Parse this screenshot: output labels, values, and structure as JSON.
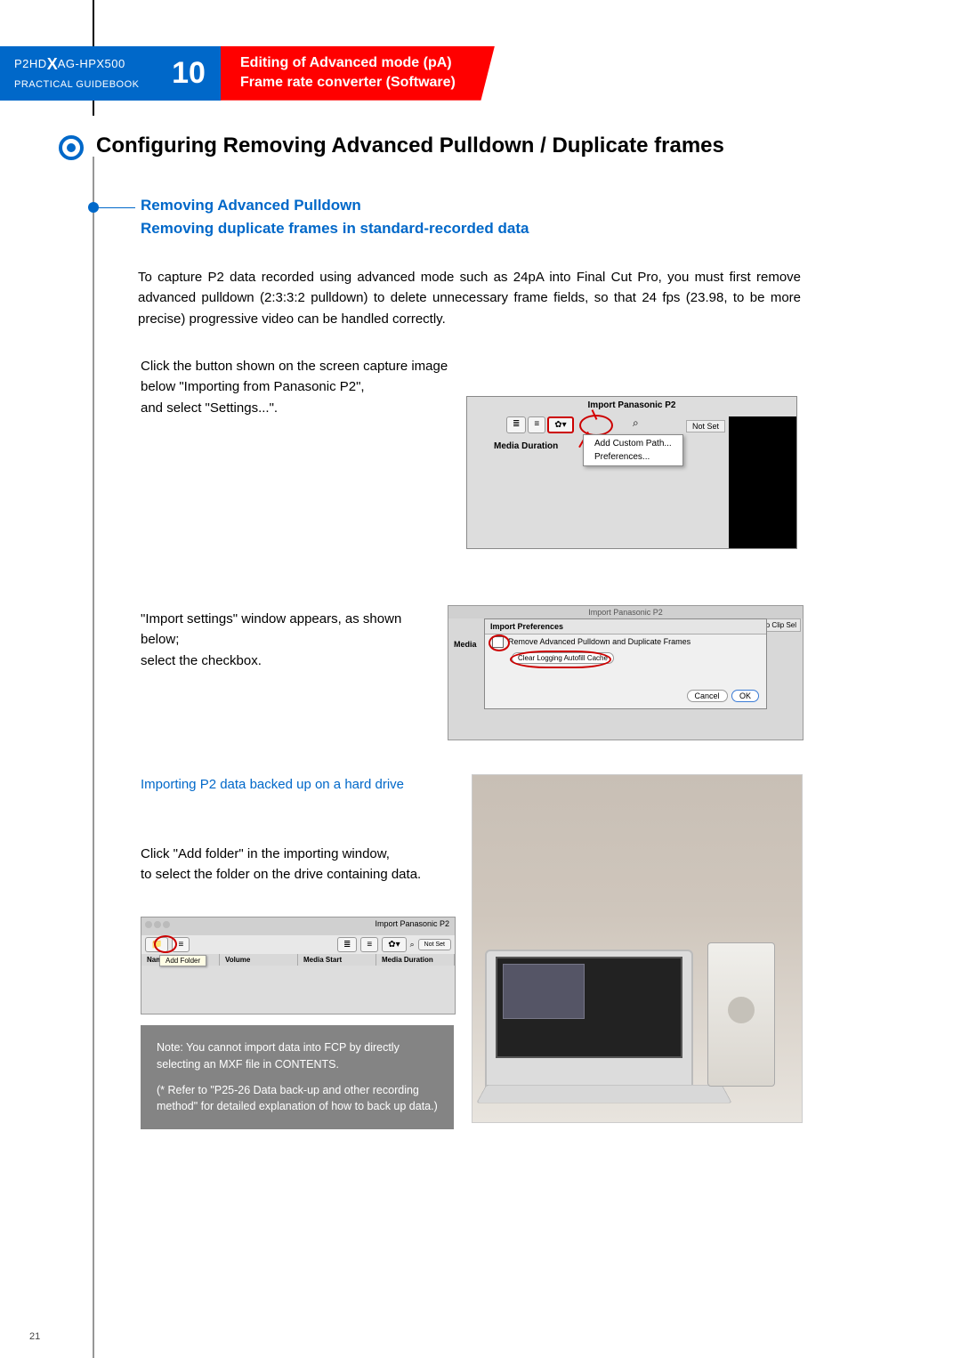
{
  "brand_line1_a": "P2HD",
  "brand_line1_b": "AG-HPX500",
  "brand_line2": "PRACTICAL GUIDEBOOK",
  "chapter_number": "10",
  "chapter_title_1": "Editing of Advanced mode (pA)",
  "chapter_title_2": "Frame rate converter (Software)",
  "main_heading": "Configuring Removing Advanced Pulldown / Duplicate frames",
  "sub_heading_1a": "Removing Advanced Pulldown",
  "sub_heading_1b": "Removing duplicate frames in standard-recorded data",
  "intro_para": "To capture P2 data recorded using advanced mode such as 24pA into Final Cut Pro, you must first remove advanced pulldown (2:3:3:2 pulldown) to delete unnecessary frame fields, so that 24 fps (23.98, to be more precise) progressive video can be handled correctly.",
  "step1_a": "Click the button shown on the screen capture image",
  "step1_b": "below \"Importing from Panasonic P2\",",
  "step1_c": "and select \"Settings...\".",
  "step2_a": "\"Import settings\" window appears, as shown below;",
  "step2_b": "select the checkbox.",
  "sub_heading_2": "Importing P2 data backed up on a hard drive",
  "step3_a": "Click \"Add folder\" in the importing window,",
  "step3_b": "to select the folder on the drive containing data.",
  "note_a": "Note: You cannot import data into FCP by directly selecting an MXF file in CONTENTS.",
  "note_b": "(* Refer to \"P25-26 Data back-up and other recording method\" for detailed explanation of how to back up data.)",
  "page_number": "21",
  "fig1": {
    "title": "Import Panasonic P2",
    "not_set": "Not Set",
    "menu1": "Add Custom Path...",
    "menu2": "Preferences...",
    "media_duration": "Media Duration"
  },
  "fig2": {
    "topbar": "Import Panasonic P2",
    "win_title": "Import Preferences",
    "check_label": "Remove Advanced Pulldown and Duplicate Frames",
    "clear_btn": "Clear Logging Autofill Cache",
    "cancel": "Cancel",
    "ok": "OK",
    "media": "Media",
    "noclip": "No Clip Sel"
  },
  "fig3": {
    "title": "Import Panasonic P2",
    "add_folder": "Add Folder",
    "col1": "Name",
    "col2": "Volume",
    "col3": "Media Start",
    "col4": "Media Duration",
    "not_set": "Not Set"
  }
}
